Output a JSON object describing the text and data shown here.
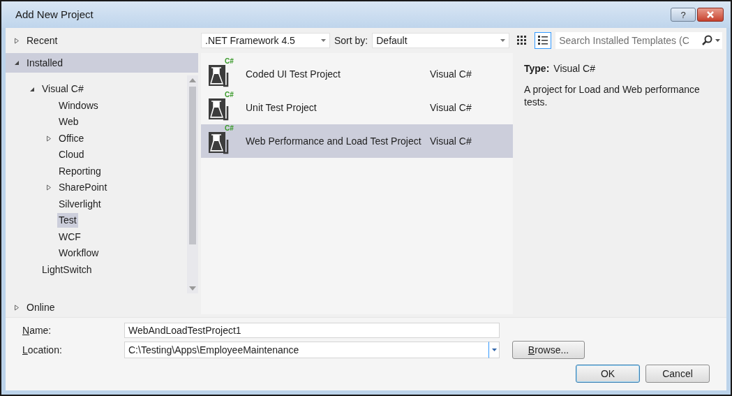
{
  "window": {
    "title": "Add New Project",
    "help_button": "?"
  },
  "sidebar": {
    "sections": [
      {
        "label": "Recent",
        "expanded": false,
        "selected": false
      },
      {
        "label": "Installed",
        "expanded": true,
        "selected": true,
        "children": [
          {
            "label": "Visual C#",
            "expanded": true,
            "selected": false,
            "children": [
              {
                "label": "Windows",
                "selected": false
              },
              {
                "label": "Web",
                "selected": false
              },
              {
                "label": "Office",
                "expanded": false,
                "selected": false
              },
              {
                "label": "Cloud",
                "selected": false
              },
              {
                "label": "Reporting",
                "selected": false
              },
              {
                "label": "SharePoint",
                "expanded": false,
                "selected": false
              },
              {
                "label": "Silverlight",
                "selected": false
              },
              {
                "label": "Test",
                "selected": true
              },
              {
                "label": "WCF",
                "selected": false
              },
              {
                "label": "Workflow",
                "selected": false
              }
            ]
          },
          {
            "label": "LightSwitch",
            "selected": false
          }
        ]
      },
      {
        "label": "Online",
        "expanded": false,
        "selected": false
      }
    ]
  },
  "toolbar": {
    "framework": ".NET Framework 4.5",
    "sort_label": "Sort by:",
    "sort_value": "Default",
    "views": [
      {
        "kind": "grid",
        "selected": false
      },
      {
        "kind": "list",
        "selected": true
      }
    ],
    "search": {
      "placeholder": "Search Installed Templates (C"
    }
  },
  "templates": [
    {
      "name": "Coded UI Test Project",
      "language": "Visual C#",
      "badge": "C#",
      "selected": false
    },
    {
      "name": "Unit Test Project",
      "language": "Visual C#",
      "badge": "C#",
      "selected": false
    },
    {
      "name": "Web Performance and Load Test Project",
      "language": "Visual C#",
      "badge": "C#",
      "selected": true
    }
  ],
  "details": {
    "type_label": "Type:",
    "type_value": "Visual C#",
    "description": "A project for Load and Web performance tests."
  },
  "form": {
    "name_label": "Name:",
    "name_value": "WebAndLoadTestProject1",
    "location_label": "Location:",
    "location_value": "C:\\Testing\\Apps\\EmployeeMaintenance",
    "browse": "Browse..."
  },
  "buttons": [
    "OK",
    "Cancel"
  ]
}
